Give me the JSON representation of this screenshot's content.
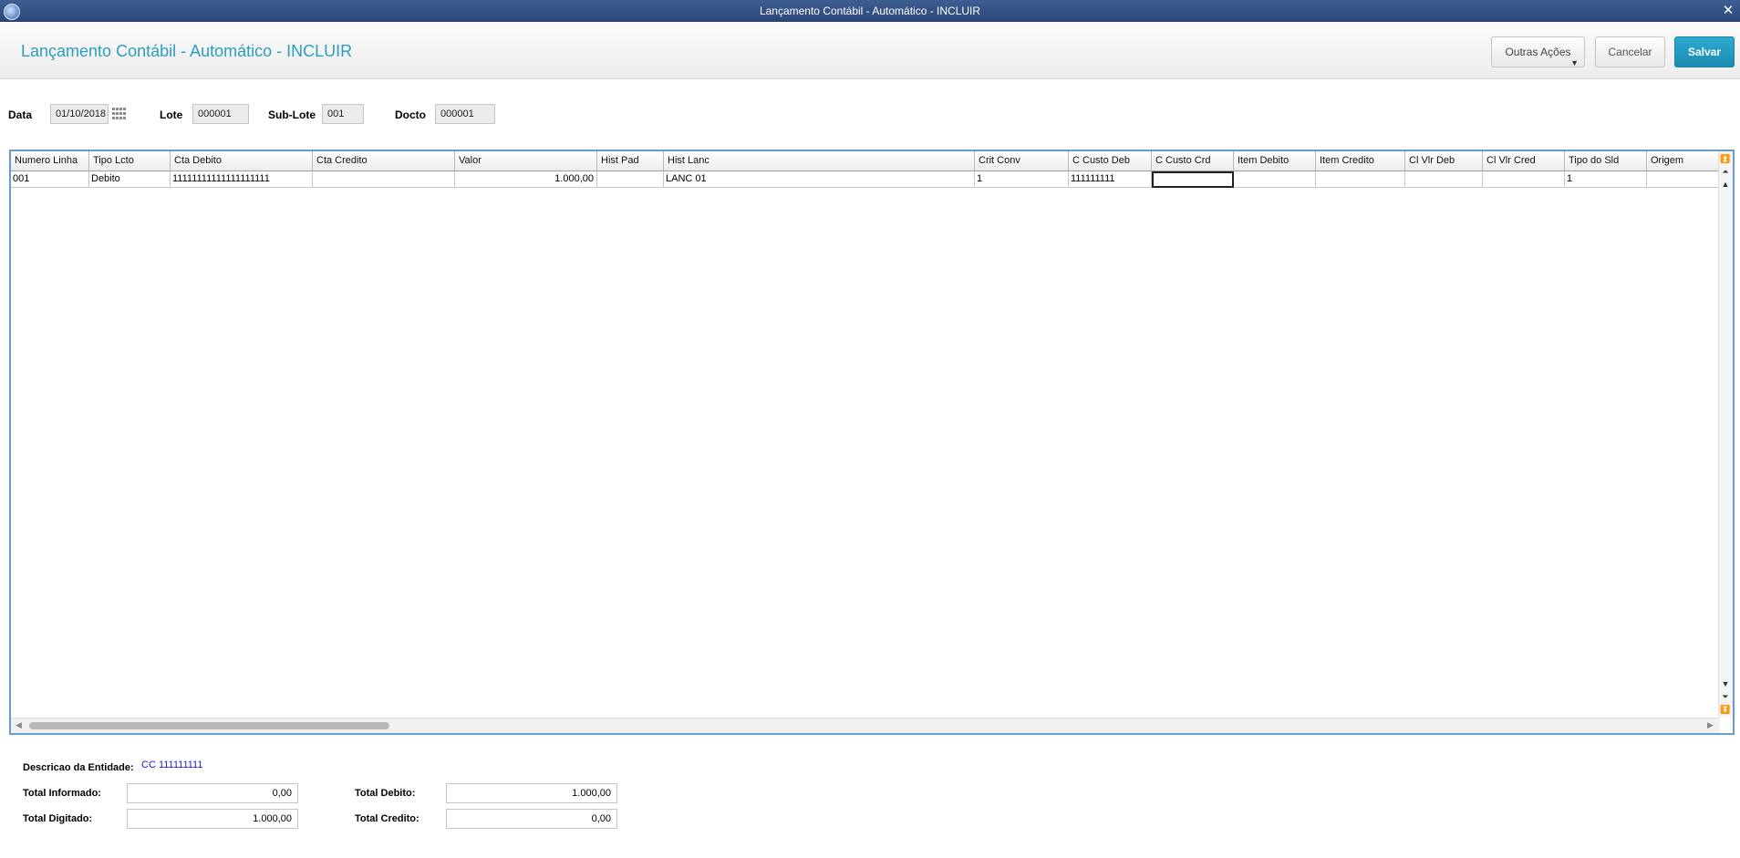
{
  "window": {
    "title": "Lançamento Contábil - Automático - INCLUIR",
    "close_glyph": "✕"
  },
  "header": {
    "title": "Lançamento Contábil - Automático - INCLUIR",
    "buttons": {
      "other_actions": "Outras Ações",
      "cancel": "Cancelar",
      "save": "Salvar"
    },
    "accent_color": "#2c9dbd"
  },
  "form": {
    "date_label": "Data",
    "date_value": "01/10/2018",
    "lote_label": "Lote",
    "lote_value": "000001",
    "sublote_label": "Sub-Lote",
    "sublote_value": "001",
    "docto_label": "Docto",
    "docto_value": "000001"
  },
  "grid": {
    "columns": [
      "Numero Linha",
      "Tipo Lcto",
      "Cta Debito",
      "Cta Credito",
      "Valor",
      "Hist Pad",
      "Hist Lanc",
      "Crit Conv",
      "C Custo Deb",
      "C Custo Crd",
      "Item Debito",
      "Item Credito",
      "Cl Vlr Deb",
      "Cl Vlr Cred",
      "Tipo do Sld",
      "Origem"
    ],
    "rows": [
      [
        "001",
        "Debito",
        "11111111111111111111",
        "",
        "1.000,00",
        "",
        "LANC 01",
        "1",
        "111111111",
        "",
        "",
        "",
        "",
        "",
        "1",
        ""
      ]
    ],
    "border_color": "#6a9bc9"
  },
  "footer": {
    "entity_label": "Descricao da Entidade:",
    "entity_value": "CC 111111111",
    "total_informado_label": "Total Informado:",
    "total_informado_value": "0,00",
    "total_digitado_label": "Total Digitado:",
    "total_digitado_value": "1.000,00",
    "total_debito_label": "Total Debito:",
    "total_debito_value": "1.000,00",
    "total_credito_label": "Total Credito:",
    "total_credito_value": "0,00"
  }
}
